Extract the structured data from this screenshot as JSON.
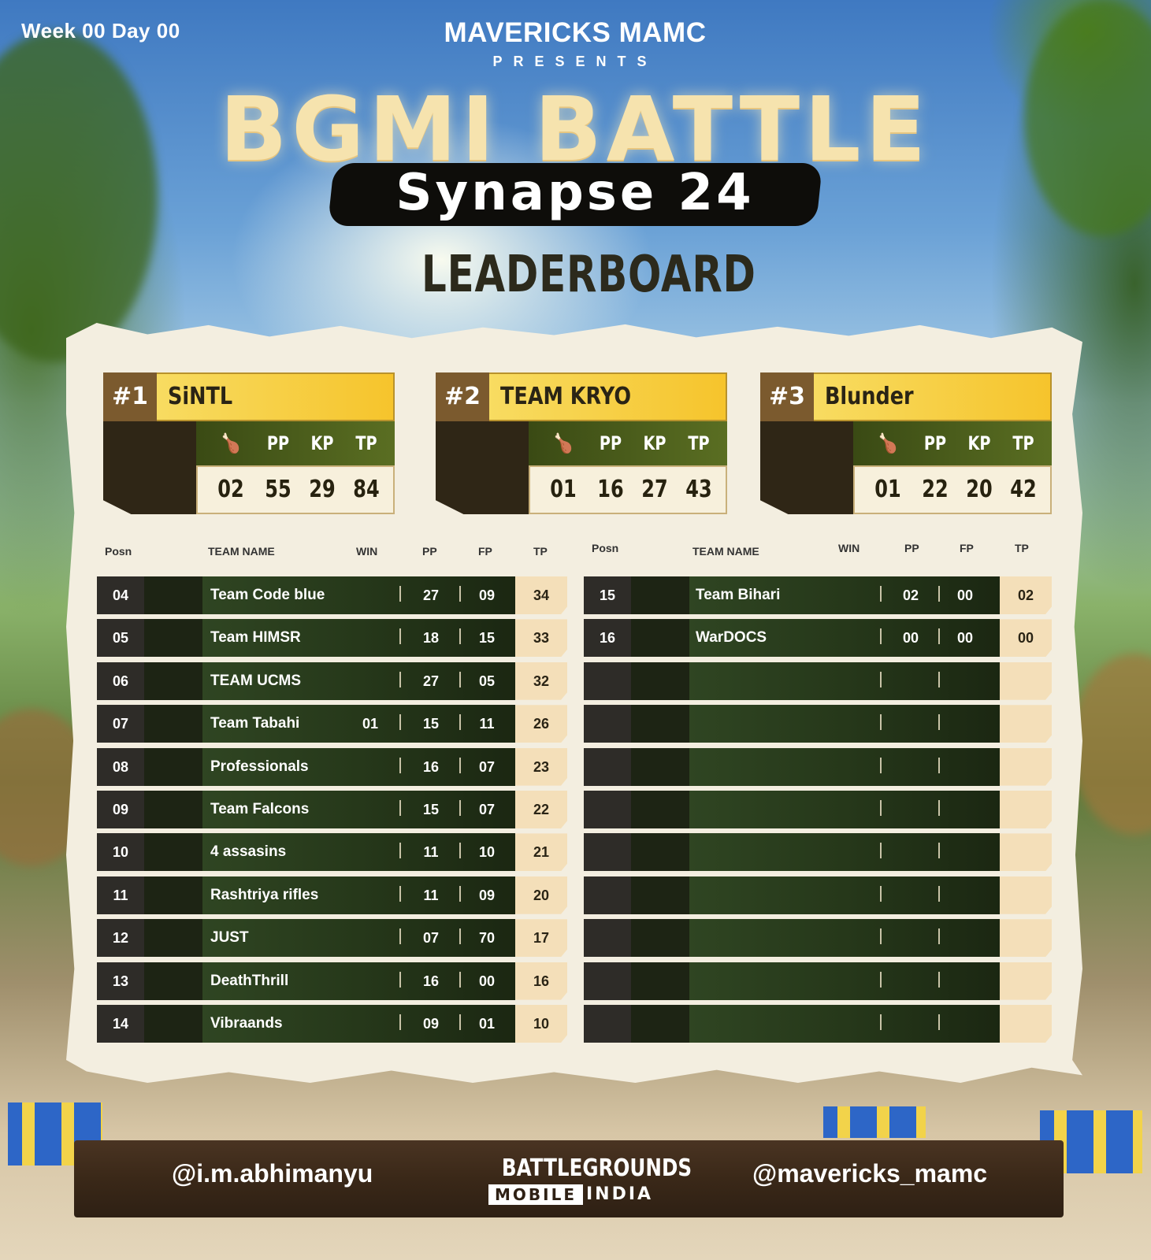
{
  "header": {
    "week_day": "Week 00 Day 00",
    "organizer": "MAVERICKS MAMC",
    "presents": "PRESENTS",
    "title": "BGMI BATTLE",
    "subtitle": "Synapse 24",
    "board_title": "LEADERBOARD"
  },
  "top3": {
    "stat_headers": {
      "icon": "chicken-dinner-icon",
      "pp": "PP",
      "kp": "KP",
      "tp": "TP"
    },
    "teams": [
      {
        "rank": "#1",
        "name": "SiNTL",
        "wins": "02",
        "pp": "55",
        "kp": "29",
        "tp": "84"
      },
      {
        "rank": "#2",
        "name": "TEAM KRYO",
        "wins": "01",
        "pp": "16",
        "kp": "27",
        "tp": "43"
      },
      {
        "rank": "#3",
        "name": "Blunder",
        "wins": "01",
        "pp": "22",
        "kp": "20",
        "tp": "42"
      }
    ]
  },
  "table_headers": {
    "posn": "Posn",
    "team_name": "TEAM NAME",
    "win": "WIN",
    "pp": "PP",
    "fp": "FP",
    "tp": "TP"
  },
  "left_rows": [
    {
      "pos": "04",
      "name": "Team Code blue",
      "win": "",
      "pp": "27",
      "fp": "09",
      "tp": "34"
    },
    {
      "pos": "05",
      "name": "Team HIMSR",
      "win": "",
      "pp": "18",
      "fp": "15",
      "tp": "33"
    },
    {
      "pos": "06",
      "name": "TEAM UCMS",
      "win": "",
      "pp": "27",
      "fp": "05",
      "tp": "32"
    },
    {
      "pos": "07",
      "name": "Team Tabahi",
      "win": "01",
      "pp": "15",
      "fp": "11",
      "tp": "26"
    },
    {
      "pos": "08",
      "name": "Professionals",
      "win": "",
      "pp": "16",
      "fp": "07",
      "tp": "23"
    },
    {
      "pos": "09",
      "name": "Team Falcons",
      "win": "",
      "pp": "15",
      "fp": "07",
      "tp": "22"
    },
    {
      "pos": "10",
      "name": "4 assasins",
      "win": "",
      "pp": "11",
      "fp": "10",
      "tp": "21"
    },
    {
      "pos": "11",
      "name": "Rashtriya rifles",
      "win": "",
      "pp": "11",
      "fp": "09",
      "tp": "20"
    },
    {
      "pos": "12",
      "name": "JUST",
      "win": "",
      "pp": "07",
      "fp": "70",
      "tp": "17"
    },
    {
      "pos": "13",
      "name": "DeathThrill",
      "win": "",
      "pp": "16",
      "fp": "00",
      "tp": "16"
    },
    {
      "pos": "14",
      "name": "Vibraands",
      "win": "",
      "pp": "09",
      "fp": "01",
      "tp": "10"
    }
  ],
  "right_rows": [
    {
      "pos": "15",
      "name": "Team Bihari",
      "win": "",
      "pp": "02",
      "fp": "00",
      "tp": "02"
    },
    {
      "pos": "16",
      "name": "WarDOCS",
      "win": "",
      "pp": "00",
      "fp": "00",
      "tp": "00"
    },
    {
      "pos": "",
      "name": "",
      "win": "",
      "pp": "",
      "fp": "",
      "tp": ""
    },
    {
      "pos": "",
      "name": "",
      "win": "",
      "pp": "",
      "fp": "",
      "tp": ""
    },
    {
      "pos": "",
      "name": "",
      "win": "",
      "pp": "",
      "fp": "",
      "tp": ""
    },
    {
      "pos": "",
      "name": "",
      "win": "",
      "pp": "",
      "fp": "",
      "tp": ""
    },
    {
      "pos": "",
      "name": "",
      "win": "",
      "pp": "",
      "fp": "",
      "tp": ""
    },
    {
      "pos": "",
      "name": "",
      "win": "",
      "pp": "",
      "fp": "",
      "tp": ""
    },
    {
      "pos": "",
      "name": "",
      "win": "",
      "pp": "",
      "fp": "",
      "tp": ""
    },
    {
      "pos": "",
      "name": "",
      "win": "",
      "pp": "",
      "fp": "",
      "tp": ""
    },
    {
      "pos": "",
      "name": "",
      "win": "",
      "pp": "",
      "fp": "",
      "tp": ""
    }
  ],
  "footer": {
    "left_handle": "@i.m.abhimanyu",
    "right_handle": "@mavericks_mamc",
    "logo_line1": "BATTLEGROUNDS",
    "logo_mobile": "MOBILE",
    "logo_india": "INDIA"
  }
}
